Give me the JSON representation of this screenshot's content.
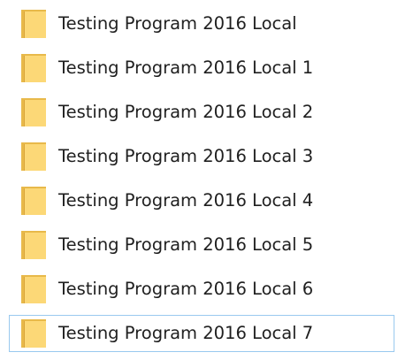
{
  "folders": {
    "icon": "folder-icon",
    "icon_colors": {
      "back": "#e8b94a",
      "front": "#fcd877",
      "edge": "#d9a53c"
    },
    "focus_border_color": "#99c9ef",
    "items": [
      {
        "name": "Testing Program 2016 Local"
      },
      {
        "name": "Testing Program 2016 Local 1"
      },
      {
        "name": "Testing Program 2016 Local 2"
      },
      {
        "name": "Testing Program 2016 Local 3"
      },
      {
        "name": "Testing Program 2016 Local 4"
      },
      {
        "name": "Testing Program 2016 Local 5"
      },
      {
        "name": "Testing Program 2016 Local 6"
      },
      {
        "name": "Testing Program 2016 Local 7",
        "focused": true
      }
    ]
  }
}
